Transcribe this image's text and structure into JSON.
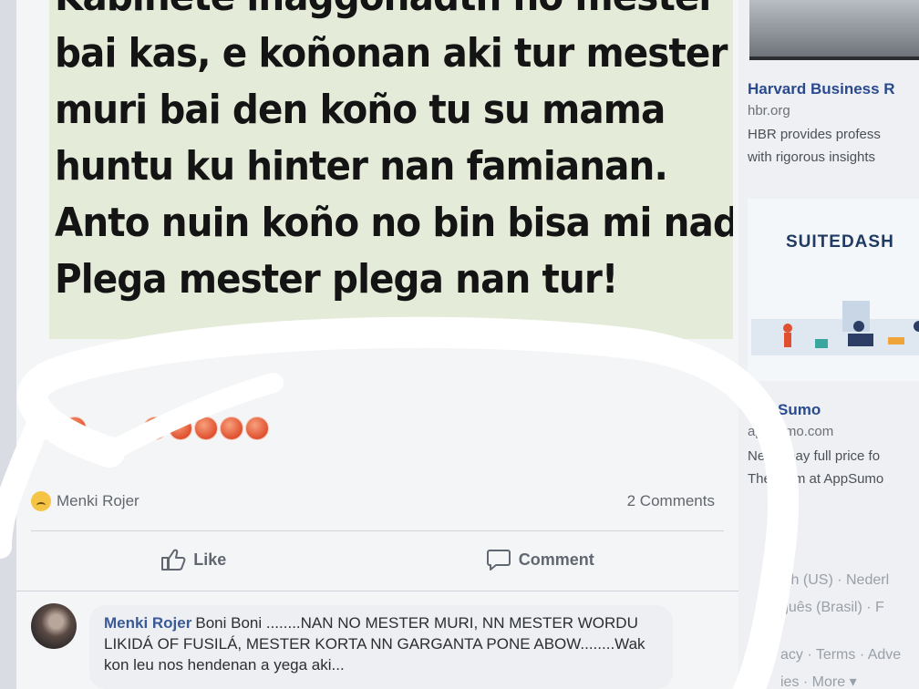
{
  "post": {
    "image_text_lines": [
      "Kabinete inaggonadth no mester",
      "bai kas, e koñonan aki tur mester",
      "muri bai den koño tu su mama",
      "huntu ku hinter nan famianan.",
      "Anto nuin koño no bin bisa mi nad",
      "Plega mester  plega nan tur!"
    ],
    "reaction_user": "Menki Rojer",
    "comment_count": "2 Comments",
    "like_label": "Like",
    "comment_label": "Comment"
  },
  "comment": {
    "author": "Menki Rojer",
    "text": "Boni Boni ........NAN NO MESTER MURI, NN MESTER WORDU LIKIDÁ OF FUSILÁ, MESTER KORTA NN GARGANTA PONE ABOW........Wak kon leu nos hendenan a yega aki..."
  },
  "sidebar": {
    "ad1": {
      "title": "Harvard Business R",
      "domain": "hbr.org",
      "desc_line1": "HBR provides profess",
      "desc_line2": "with rigorous insights"
    },
    "ad2": {
      "logo": "SUITEDASH",
      "title": "AppSumo",
      "domain": "appsumo.com",
      "desc_line1": "Never pay full price fo",
      "desc_line2": "The team at AppSumo"
    },
    "footer_line1": "ish (US) · Nederl",
    "footer_line2": "guês (Brasil) · F",
    "footer_line3": "acy · Terms · Adve",
    "footer_line4": "ies · More ▾"
  },
  "colors": {
    "link_blue": "#3b5998",
    "post_image_bg": "#e4ebd9",
    "reaction_orange": "#e0502e"
  }
}
